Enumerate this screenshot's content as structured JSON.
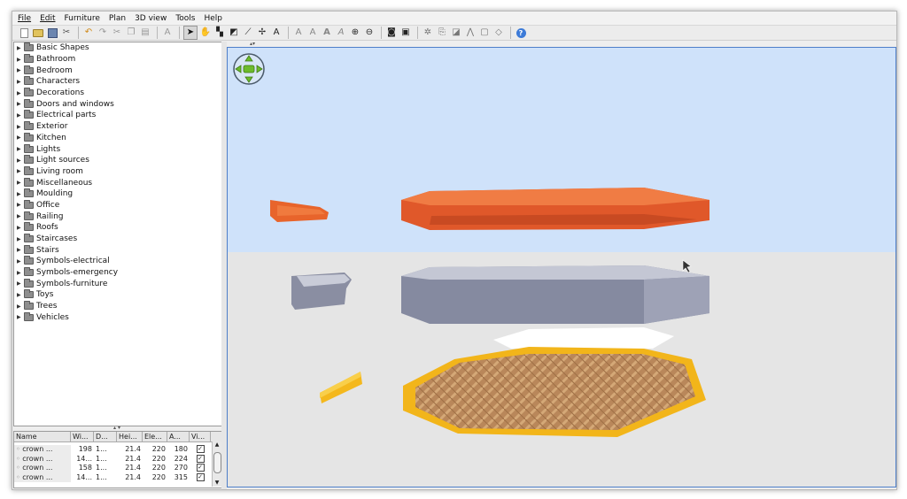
{
  "menu": [
    {
      "u": "F",
      "rest": "ile"
    },
    {
      "u": "E",
      "rest": "dit"
    },
    {
      "u": "",
      "pre": "F",
      "u2": "u",
      "rest": "rniture"
    },
    {
      "u": "P",
      "rest": "lan"
    },
    {
      "u": "",
      "pre": "3D ",
      "u2": "v",
      "rest": "iew"
    },
    {
      "u": "T",
      "rest": "ools"
    },
    {
      "u": "H",
      "rest": "elp"
    }
  ],
  "menu_labels": [
    "File",
    "Edit",
    "Furniture",
    "Plan",
    "3D view",
    "Tools",
    "Help"
  ],
  "catalog": [
    "Basic Shapes",
    "Bathroom",
    "Bedroom",
    "Characters",
    "Decorations",
    "Doors and windows",
    "Electrical parts",
    "Exterior",
    "Kitchen",
    "Lights",
    "Light sources",
    "Living room",
    "Miscellaneous",
    "Moulding",
    "Office",
    "Railing",
    "Roofs",
    "Staircases",
    "Stairs",
    "Symbols-electrical",
    "Symbols-emergency",
    "Symbols-furniture",
    "Toys",
    "Trees",
    "Vehicles"
  ],
  "table": {
    "headers": [
      "Name",
      "Wi...",
      "D...",
      "Hei...",
      "Ele...",
      "A...",
      "Vi..."
    ],
    "rows": [
      {
        "name": "crown ...",
        "w": "198",
        "d": "1...",
        "h": "21.4",
        "e": "220",
        "a": "180",
        "v": "✓"
      },
      {
        "name": "crown ...",
        "w": "14...",
        "d": "1...",
        "h": "21.4",
        "e": "220",
        "a": "224",
        "v": "✓"
      },
      {
        "name": "crown ...",
        "w": "158",
        "d": "1...",
        "h": "21.4",
        "e": "220",
        "a": "270",
        "v": "✓"
      },
      {
        "name": "crown ...",
        "w": "14...",
        "d": "1...",
        "h": "21.4",
        "e": "220",
        "a": "315",
        "v": "✓"
      }
    ]
  },
  "colors": {
    "sky": "#cfe2fa",
    "ground": "#e5e5e5",
    "orange": "#e8642b",
    "gray": "#8a8ea2",
    "yellow": "#f4b81d",
    "view_border": "#4d7ec9"
  }
}
